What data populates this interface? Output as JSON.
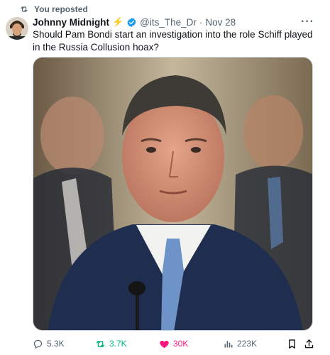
{
  "repost": {
    "label": "You reposted"
  },
  "author": {
    "display_name": "Johnny Midnight",
    "emoji": "⚡",
    "handle": "@its_The_Dr",
    "separator": "·",
    "date": "Nov 28"
  },
  "tweet": {
    "text": "Should Pam Bondi start an investigation into the role Schiff played in the Russia Collusion hoax?"
  },
  "metrics": {
    "replies": "5.3K",
    "reposts": "3.7K",
    "likes": "30K",
    "views": "223K"
  },
  "colors": {
    "text_primary": "#0f1419",
    "text_secondary": "#536471",
    "verified_blue": "#1d9bf0",
    "repost_green": "#00ba7c",
    "like_pink": "#f91880"
  },
  "icons": {
    "repost": "repost-icon",
    "verified": "verified-badge-icon",
    "more": "more-icon",
    "reply": "reply-icon",
    "like": "heart-icon",
    "views": "views-icon",
    "bookmark": "bookmark-icon",
    "share": "share-icon"
  }
}
